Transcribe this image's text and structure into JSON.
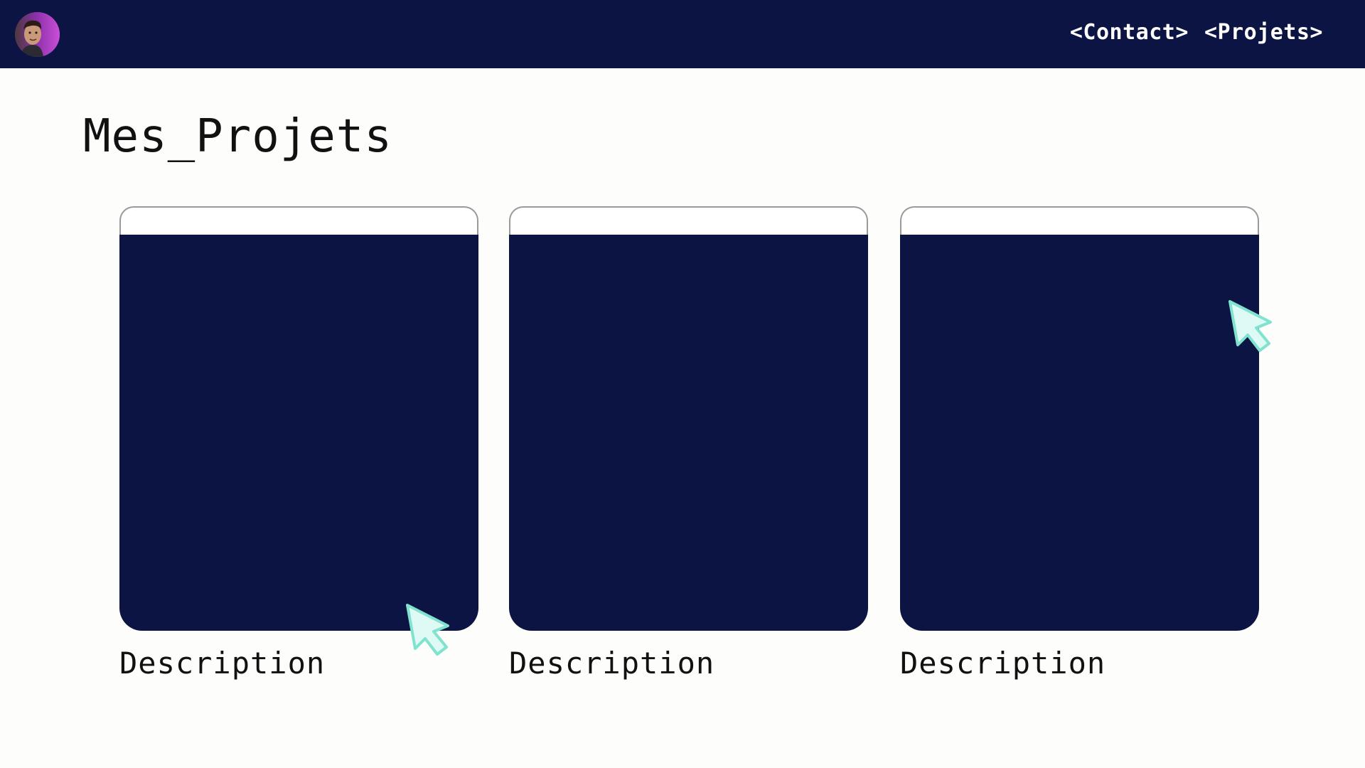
{
  "header": {
    "nav": [
      {
        "label": "<Contact>"
      },
      {
        "label": "<Projets>"
      }
    ]
  },
  "main": {
    "title": "Mes_Projets",
    "cards": [
      {
        "description": "Description"
      },
      {
        "description": "Description"
      },
      {
        "description": "Description"
      }
    ]
  },
  "colors": {
    "navy": "#0b1442",
    "cursor_fill": "#dffaf4",
    "cursor_stroke": "#7fe3cf",
    "avatar_accent": "#b332d1"
  },
  "icons": {
    "avatar": "user-photo",
    "cursor": "arrow-cursor-icon"
  }
}
